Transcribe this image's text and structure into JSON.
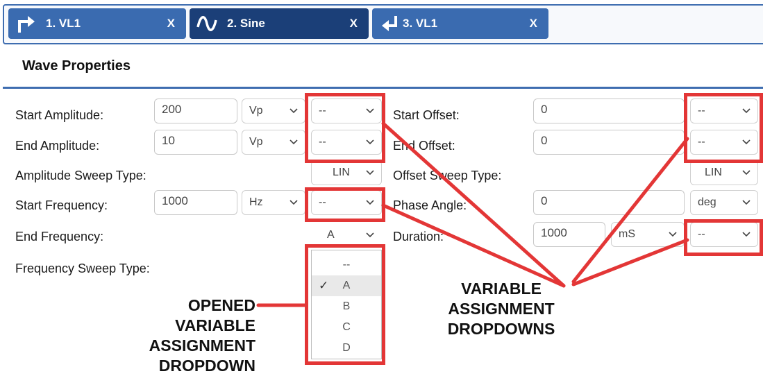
{
  "tabs": [
    {
      "label": "1. VL1",
      "close": "X",
      "icon": "turn-right-arrow-icon"
    },
    {
      "label": "2. Sine",
      "close": "X",
      "icon": "sine-wave-icon"
    },
    {
      "label": "3. VL1",
      "close": "X",
      "icon": "return-arrow-icon"
    }
  ],
  "section_title": "Wave Properties",
  "left": {
    "start_amplitude": {
      "label": "Start Amplitude:",
      "value": "200",
      "unit": "Vp",
      "var": "--"
    },
    "end_amplitude": {
      "label": "End Amplitude:",
      "value": "10",
      "unit": "Vp",
      "var": "--"
    },
    "amplitude_sweep": {
      "label": "Amplitude Sweep Type:",
      "value": "LIN"
    },
    "start_frequency": {
      "label": "Start Frequency:",
      "value": "1000",
      "unit": "Hz",
      "var": "--"
    },
    "end_frequency": {
      "label": "End Frequency:",
      "var": "A"
    },
    "frequency_sweep": {
      "label": "Frequency Sweep Type:"
    }
  },
  "right": {
    "start_offset": {
      "label": "Start Offset:",
      "value": "0",
      "var": "--"
    },
    "end_offset": {
      "label": "End Offset:",
      "value": "0",
      "var": "--"
    },
    "offset_sweep": {
      "label": "Offset Sweep Type:",
      "value": "LIN"
    },
    "phase_angle": {
      "label": "Phase Angle:",
      "value": "0",
      "unit": "deg"
    },
    "duration": {
      "label": "Duration:",
      "value": "1000",
      "unit": "mS",
      "var": "--"
    }
  },
  "dropdown_options": [
    "--",
    "A",
    "B",
    "C",
    "D"
  ],
  "dropdown_selected": "A",
  "callouts": {
    "opened": [
      "OPENED",
      "VARIABLE",
      "ASSIGNMENT",
      "DROPDOWN"
    ],
    "variable": [
      "VARIABLE",
      "ASSIGNMENT",
      "DROPDOWNS"
    ]
  },
  "colors": {
    "tab_light": "#3a6bb0",
    "tab_dark": "#1b3f78",
    "highlight": "#e33636",
    "rule": "#3e6db0"
  }
}
